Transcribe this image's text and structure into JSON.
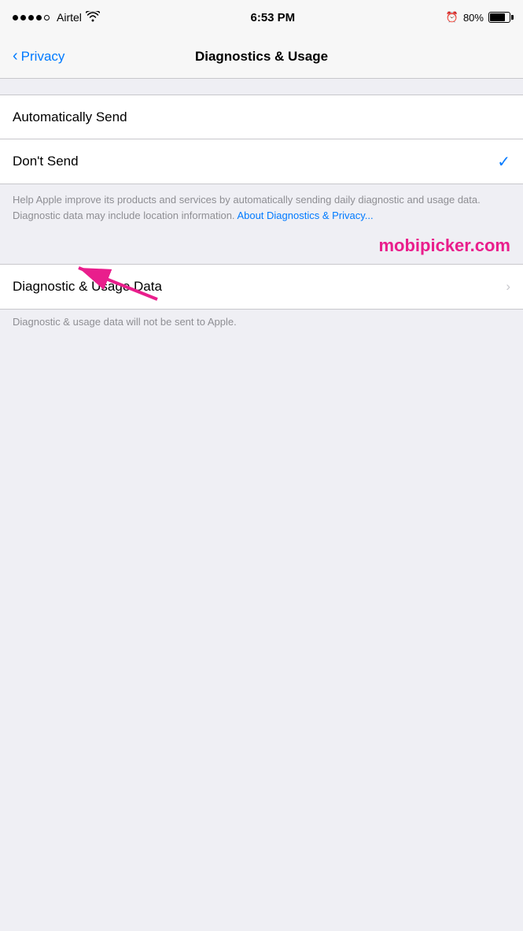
{
  "statusBar": {
    "carrier": "Airtel",
    "time": "6:53 PM",
    "batteryPercent": "80%"
  },
  "navBar": {
    "backLabel": "Privacy",
    "title": "Diagnostics & Usage"
  },
  "options": [
    {
      "label": "Automatically Send",
      "selected": false
    },
    {
      "label": "Don't Send",
      "selected": true
    }
  ],
  "infoText": "Help Apple improve its products and services by automatically sending daily diagnostic and usage data. Diagnostic data may include location information. ",
  "infoLinkText": "About Diagnostics & Privacy...",
  "watermark": "mobipicker.com",
  "diagnosticsSection": {
    "rowLabel": "Diagnostic & Usage Data",
    "subText": "Diagnostic & usage data will not be sent to Apple."
  }
}
